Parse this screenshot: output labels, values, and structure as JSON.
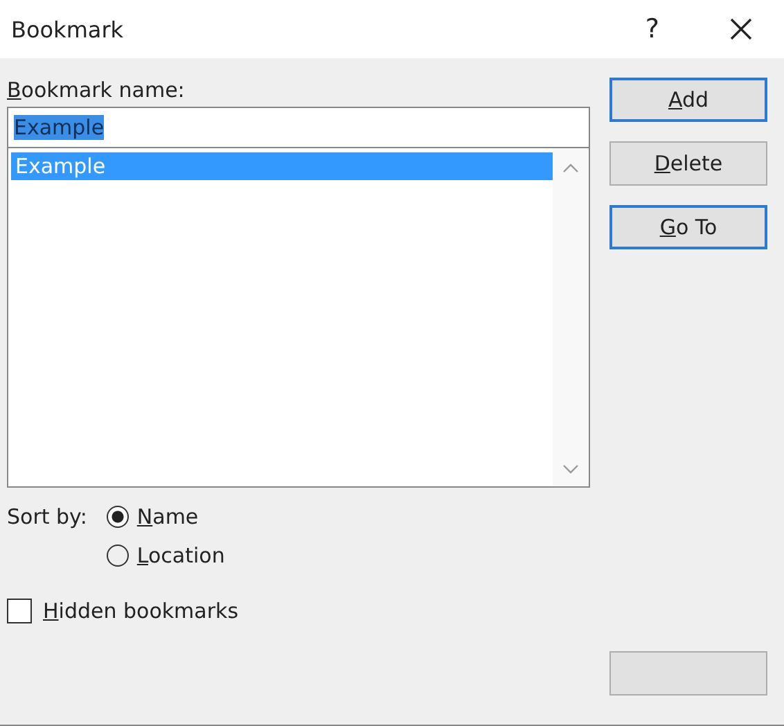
{
  "window": {
    "title": "Bookmark",
    "help": "?"
  },
  "name_field": {
    "label": "Bookmark name:",
    "value": "Example",
    "text_selected": true
  },
  "bookmarks": [
    {
      "label": "Example",
      "selected": true
    }
  ],
  "buttons": [
    {
      "label": "Add",
      "focused": true
    },
    {
      "label": "Delete",
      "focused": false
    },
    {
      "label": "Go To",
      "focused": true
    }
  ],
  "sort": {
    "label": "Sort by:",
    "options": [
      {
        "label": "Name",
        "selected": true
      },
      {
        "label": "Location",
        "selected": false
      }
    ]
  },
  "hidden_bookmarks": {
    "label": "Hidden bookmarks",
    "checked": false
  },
  "footer_buttons": [
    {
      "focused": false
    }
  ]
}
